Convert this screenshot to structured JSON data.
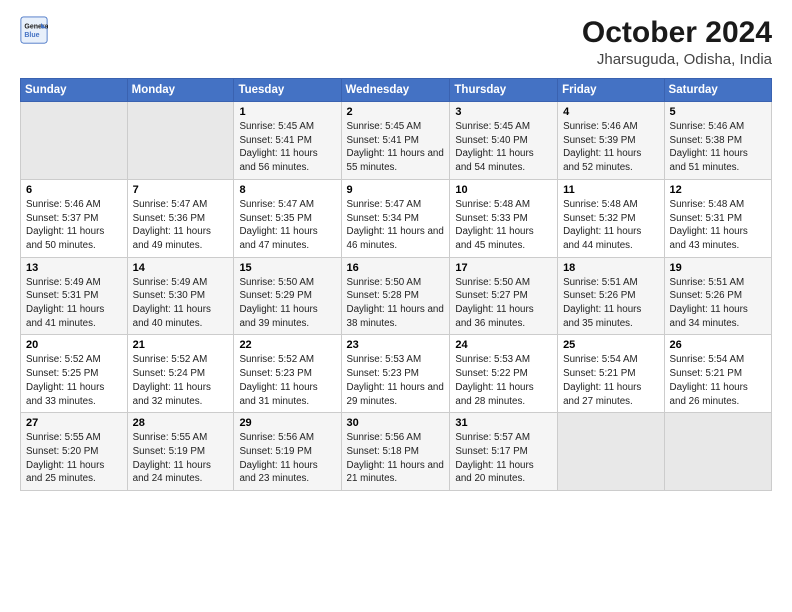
{
  "logo": {
    "line1": "General",
    "line2": "Blue"
  },
  "title": "October 2024",
  "subtitle": "Jharsuguda, Odisha, India",
  "weekdays": [
    "Sunday",
    "Monday",
    "Tuesday",
    "Wednesday",
    "Thursday",
    "Friday",
    "Saturday"
  ],
  "weeks": [
    [
      {
        "day": "",
        "info": ""
      },
      {
        "day": "",
        "info": ""
      },
      {
        "day": "1",
        "info": "Sunrise: 5:45 AM\nSunset: 5:41 PM\nDaylight: 11 hours and 56 minutes."
      },
      {
        "day": "2",
        "info": "Sunrise: 5:45 AM\nSunset: 5:41 PM\nDaylight: 11 hours and 55 minutes."
      },
      {
        "day": "3",
        "info": "Sunrise: 5:45 AM\nSunset: 5:40 PM\nDaylight: 11 hours and 54 minutes."
      },
      {
        "day": "4",
        "info": "Sunrise: 5:46 AM\nSunset: 5:39 PM\nDaylight: 11 hours and 52 minutes."
      },
      {
        "day": "5",
        "info": "Sunrise: 5:46 AM\nSunset: 5:38 PM\nDaylight: 11 hours and 51 minutes."
      }
    ],
    [
      {
        "day": "6",
        "info": "Sunrise: 5:46 AM\nSunset: 5:37 PM\nDaylight: 11 hours and 50 minutes."
      },
      {
        "day": "7",
        "info": "Sunrise: 5:47 AM\nSunset: 5:36 PM\nDaylight: 11 hours and 49 minutes."
      },
      {
        "day": "8",
        "info": "Sunrise: 5:47 AM\nSunset: 5:35 PM\nDaylight: 11 hours and 47 minutes."
      },
      {
        "day": "9",
        "info": "Sunrise: 5:47 AM\nSunset: 5:34 PM\nDaylight: 11 hours and 46 minutes."
      },
      {
        "day": "10",
        "info": "Sunrise: 5:48 AM\nSunset: 5:33 PM\nDaylight: 11 hours and 45 minutes."
      },
      {
        "day": "11",
        "info": "Sunrise: 5:48 AM\nSunset: 5:32 PM\nDaylight: 11 hours and 44 minutes."
      },
      {
        "day": "12",
        "info": "Sunrise: 5:48 AM\nSunset: 5:31 PM\nDaylight: 11 hours and 43 minutes."
      }
    ],
    [
      {
        "day": "13",
        "info": "Sunrise: 5:49 AM\nSunset: 5:31 PM\nDaylight: 11 hours and 41 minutes."
      },
      {
        "day": "14",
        "info": "Sunrise: 5:49 AM\nSunset: 5:30 PM\nDaylight: 11 hours and 40 minutes."
      },
      {
        "day": "15",
        "info": "Sunrise: 5:50 AM\nSunset: 5:29 PM\nDaylight: 11 hours and 39 minutes."
      },
      {
        "day": "16",
        "info": "Sunrise: 5:50 AM\nSunset: 5:28 PM\nDaylight: 11 hours and 38 minutes."
      },
      {
        "day": "17",
        "info": "Sunrise: 5:50 AM\nSunset: 5:27 PM\nDaylight: 11 hours and 36 minutes."
      },
      {
        "day": "18",
        "info": "Sunrise: 5:51 AM\nSunset: 5:26 PM\nDaylight: 11 hours and 35 minutes."
      },
      {
        "day": "19",
        "info": "Sunrise: 5:51 AM\nSunset: 5:26 PM\nDaylight: 11 hours and 34 minutes."
      }
    ],
    [
      {
        "day": "20",
        "info": "Sunrise: 5:52 AM\nSunset: 5:25 PM\nDaylight: 11 hours and 33 minutes."
      },
      {
        "day": "21",
        "info": "Sunrise: 5:52 AM\nSunset: 5:24 PM\nDaylight: 11 hours and 32 minutes."
      },
      {
        "day": "22",
        "info": "Sunrise: 5:52 AM\nSunset: 5:23 PM\nDaylight: 11 hours and 31 minutes."
      },
      {
        "day": "23",
        "info": "Sunrise: 5:53 AM\nSunset: 5:23 PM\nDaylight: 11 hours and 29 minutes."
      },
      {
        "day": "24",
        "info": "Sunrise: 5:53 AM\nSunset: 5:22 PM\nDaylight: 11 hours and 28 minutes."
      },
      {
        "day": "25",
        "info": "Sunrise: 5:54 AM\nSunset: 5:21 PM\nDaylight: 11 hours and 27 minutes."
      },
      {
        "day": "26",
        "info": "Sunrise: 5:54 AM\nSunset: 5:21 PM\nDaylight: 11 hours and 26 minutes."
      }
    ],
    [
      {
        "day": "27",
        "info": "Sunrise: 5:55 AM\nSunset: 5:20 PM\nDaylight: 11 hours and 25 minutes."
      },
      {
        "day": "28",
        "info": "Sunrise: 5:55 AM\nSunset: 5:19 PM\nDaylight: 11 hours and 24 minutes."
      },
      {
        "day": "29",
        "info": "Sunrise: 5:56 AM\nSunset: 5:19 PM\nDaylight: 11 hours and 23 minutes."
      },
      {
        "day": "30",
        "info": "Sunrise: 5:56 AM\nSunset: 5:18 PM\nDaylight: 11 hours and 21 minutes."
      },
      {
        "day": "31",
        "info": "Sunrise: 5:57 AM\nSunset: 5:17 PM\nDaylight: 11 hours and 20 minutes."
      },
      {
        "day": "",
        "info": ""
      },
      {
        "day": "",
        "info": ""
      }
    ]
  ]
}
